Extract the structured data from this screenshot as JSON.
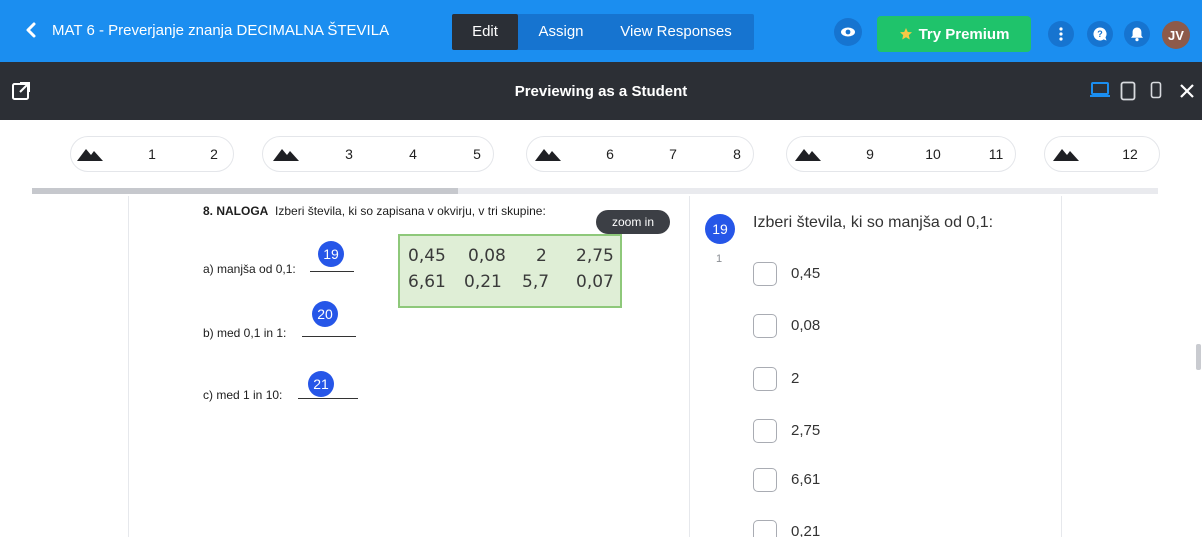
{
  "app": {
    "title": "MAT 6 - Preverjanje znanja DECIMALNA ŠTEVILA",
    "tabs": [
      "Edit",
      "Assign",
      "View Responses"
    ],
    "premium_label": "Try Premium",
    "avatar_initials": "JV"
  },
  "preview": {
    "label": "Previewing as a Student",
    "active_device": "desktop"
  },
  "navigator": {
    "groups": [
      {
        "icon": "mountain-icon",
        "numbers": [
          "1",
          "2"
        ]
      },
      {
        "icon": "mountain-icon",
        "numbers": [
          "3",
          "4",
          "5"
        ]
      },
      {
        "icon": "mountain-icon",
        "numbers": [
          "6",
          "7",
          "8"
        ]
      },
      {
        "icon": "mountain-icon",
        "numbers": [
          "9",
          "10",
          "11"
        ]
      },
      {
        "icon": "mountain-icon",
        "numbers": [
          "12"
        ]
      }
    ]
  },
  "document": {
    "task_title": "8. NALOGA",
    "task_text": "Izberi števila, ki so zapisana v okvirju, v tri skupine:",
    "zoom_label": "zoom in",
    "items": [
      {
        "label": "a) manjša od 0,1:",
        "marker": "19"
      },
      {
        "label": "b) med 0,1 in 1:",
        "marker": "20"
      },
      {
        "label": "c) med 1 in 10:",
        "marker": "21"
      }
    ],
    "box_numbers": [
      [
        "0,45",
        "0,08",
        "2",
        "2,75"
      ],
      [
        "6,61",
        "0,21",
        "5,7",
        "0,07"
      ]
    ]
  },
  "question": {
    "number": "19",
    "points": "1",
    "text": "Izberi števila, ki so manjša od 0,1:",
    "options": [
      "0,45",
      "0,08",
      "2",
      "2,75",
      "6,61",
      "0,21"
    ]
  },
  "colors": {
    "topbar": "#1b8ef0",
    "premium": "#1fc36b",
    "marker": "#2656e8",
    "previewbar": "#2c2f35"
  }
}
